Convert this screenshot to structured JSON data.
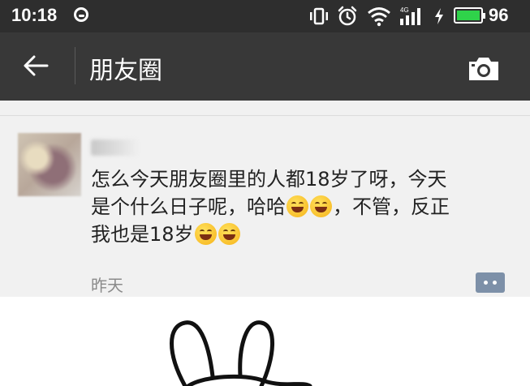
{
  "status_bar": {
    "time": "10:18",
    "battery_level": "96",
    "icons": [
      "sync-icon",
      "vibrate-icon",
      "alarm-icon",
      "wifi-icon",
      "signal-4g-icon",
      "charging-icon",
      "battery-icon"
    ],
    "battery_color": "#2fd34a"
  },
  "nav": {
    "title": "朋友圈",
    "back_icon": "back-arrow-icon",
    "camera_icon": "camera-icon"
  },
  "post": {
    "text_line1": "怎么今天朋友圈里的人都18岁了呀，今天",
    "text_line2a": "是个什么日子呢，哈哈",
    "text_line2b": "，不管，反正",
    "text_line3": "我也是18岁",
    "timestamp": "昨天",
    "comment_icon": "comment-icon"
  },
  "colors": {
    "status_bar_bg": "#2e2e2e",
    "nav_bg": "#383838",
    "feed_bg": "#f1f1f1",
    "comment_button": "#7d90a8"
  }
}
